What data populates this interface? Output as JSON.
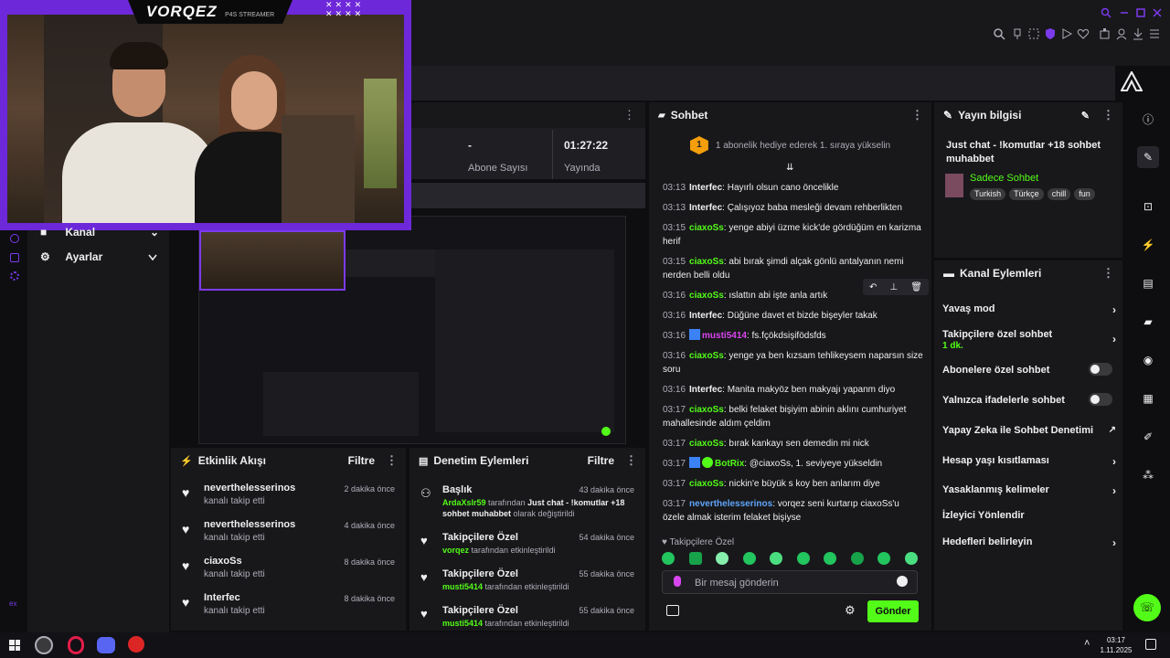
{
  "overlay": {
    "brand": "VORQEZ",
    "brand_sub": "P4S STREAMER"
  },
  "sidebar": {
    "items": [
      {
        "label": "Kanal"
      },
      {
        "label": "Ayarlar"
      }
    ]
  },
  "stats": {
    "abone_value": "-",
    "abone_label": "Abone Sayısı",
    "yayin_value": "01:27:22",
    "yayin_label": "Yayında"
  },
  "chat": {
    "title": "Sohbet",
    "pinned_badge": "1",
    "pinned": "1 abonelik hediye ederek 1. sıraya yükselin",
    "messages": [
      {
        "time": "03:13",
        "user": "Interfec",
        "color": "#efeff1",
        "text": "Hayırlı olsun cano öncelikle"
      },
      {
        "time": "03:13",
        "user": "Interfec",
        "color": "#efeff1",
        "text": "Çalışıyoz baba mesleği devam rehberlikten"
      },
      {
        "time": "03:15",
        "user": "ciaxoSs",
        "color": "#53fc18",
        "text": "yenge abiyi üzme kick'de gördüğüm en karizma herif"
      },
      {
        "time": "03:15",
        "user": "ciaxoSs",
        "color": "#53fc18",
        "text": "abi bırak şimdi alçak gönlü antalyanın nemi nerden belli oldu"
      },
      {
        "time": "03:16",
        "user": "ciaxoSs",
        "color": "#53fc18",
        "text": "ıslattın abi işte anla artık"
      },
      {
        "time": "03:16",
        "user": "Interfec",
        "color": "#efeff1",
        "text": "Düğüne davet et bizde bişeyler takak"
      },
      {
        "time": "03:16",
        "user": "musti5414",
        "color": "#d946ef",
        "text": "fs.fçökdsişifödsfds"
      },
      {
        "time": "03:16",
        "user": "ciaxoSs",
        "color": "#53fc18",
        "text": "yenge ya ben kızsam tehlikeysem naparsın size soru"
      },
      {
        "time": "03:16",
        "user": "Interfec",
        "color": "#efeff1",
        "text": "Manita makyöz ben makyajı yapanm diyo"
      },
      {
        "time": "03:17",
        "user": "ciaxoSs",
        "color": "#53fc18",
        "text": "belki felaket bişiyim abinin aklını cumhuriyet mahallesinde aldım çeldim"
      },
      {
        "time": "03:17",
        "user": "ciaxoSs",
        "color": "#53fc18",
        "text": "bırak kankayı sen demedin mi nick"
      },
      {
        "time": "03:17",
        "user": "BotRix",
        "color": "#53fc18",
        "text": "@ciaxoSs, 1. seviyeye yükseldin"
      },
      {
        "time": "03:17",
        "user": "ciaxoSs",
        "color": "#53fc18",
        "text": "nickin'e büyük s koy ben anlarım diye"
      },
      {
        "time": "03:17",
        "user": "neverthelesserinos",
        "color": "#60a5fa",
        "text": "vorqez seni kurtarıp ciaxoSs'u özele almak isterim felaket bişiyse"
      }
    ],
    "mode_label": "Takipçilere Özel",
    "input_placeholder": "Bir mesaj gönderin",
    "send_label": "Gönder"
  },
  "stream_info": {
    "title": "Yayın bilgisi",
    "stream_title": "Just chat - !komutlar +18 sohbet muhabbet",
    "category": "Sadece Sohbet",
    "tags": [
      "Turkish",
      "Türkçe",
      "chill",
      "fun"
    ]
  },
  "channel_actions": {
    "title": "Kanal Eylemleri",
    "rows": [
      {
        "label": "Yavaş mod",
        "type": "chevron"
      },
      {
        "label": "Takipçilere özel sohbet",
        "sub": "1 dk.",
        "type": "chevron"
      },
      {
        "label": "Abonelere özel sohbet",
        "type": "toggle"
      },
      {
        "label": "Yalnızca ifadelerle sohbet",
        "type": "toggle"
      },
      {
        "label": "Yapay Zeka ile Sohbet Denetimi",
        "type": "external"
      },
      {
        "label": "Hesap yaşı kısıtlaması",
        "type": "chevron"
      },
      {
        "label": "Yasaklanmış kelimeler",
        "type": "chevron"
      },
      {
        "label": "İzleyici Yönlendir",
        "type": "none"
      },
      {
        "label": "Hedefleri belirleyin",
        "type": "chevron"
      }
    ]
  },
  "activity": {
    "title": "Etkinlik Akışı",
    "filter": "Filtre",
    "events": [
      {
        "user": "neverthelesserinos",
        "action": "kanalı takip etti",
        "time": "2 dakika önce"
      },
      {
        "user": "neverthelesserinos",
        "action": "kanalı takip etti",
        "time": "4 dakika önce"
      },
      {
        "user": "ciaxoSs",
        "action": "kanalı takip etti",
        "time": "8 dakika önce"
      },
      {
        "user": "Interfec",
        "action": "kanalı takip etti",
        "time": "8 dakika önce"
      }
    ]
  },
  "moderation": {
    "title": "Denetim Eylemleri",
    "filter": "Filtre",
    "events": [
      {
        "title": "Başlık",
        "time": "43 dakika önce",
        "user": "ArdaXslr59",
        "by": "tarafından",
        "detail": "Just chat - !komutlar +18 sohbet muhabbet",
        "suffix": "olarak değiştirildi"
      },
      {
        "title": "Takipçilere Özel",
        "time": "54 dakika önce",
        "user": "vorqez",
        "by": "tarafından etkinleştirildi"
      },
      {
        "title": "Takipçilere Özel",
        "time": "55 dakika önce",
        "user": "musti5414",
        "by": "tarafından etkinleştirildi"
      },
      {
        "title": "Takipçilere Özel",
        "time": "55 dakika önce",
        "user": "musti5414",
        "by": "tarafından etkinleştirildi"
      }
    ]
  },
  "taskbar": {
    "time": "03:17",
    "date": "1.11.2025"
  },
  "colors": {
    "accent": "#53fc18",
    "purple": "#7c3aed",
    "panel": "#18181b",
    "bg": "#0e0e10"
  }
}
